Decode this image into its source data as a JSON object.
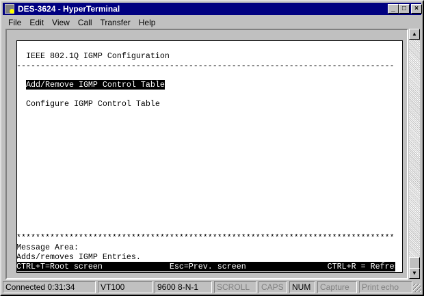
{
  "window": {
    "title": "DES-3624 - HyperTerminal",
    "min": "_",
    "max": "□",
    "close": "×"
  },
  "menu": [
    "File",
    "Edit",
    "View",
    "Call",
    "Transfer",
    "Help"
  ],
  "terminal": {
    "title": "IEEE 802.1Q IGMP Configuration",
    "divider": "-------------------------------------------------------------------------------",
    "items": [
      "Add/Remove IGMP Control Table",
      "Configure IGMP Control Table"
    ],
    "stars": "*******************************************************************************",
    "message_label": "Message Area:",
    "message": "Adds/removes IGMP Entries.",
    "footer": "CTRL+T=Root screen              Esc=Prev. screen                 CTRL+R = Refresh"
  },
  "status": {
    "connected": "Connected 0:31:34",
    "emulation": "VT100",
    "port": "9600 8-N-1",
    "scroll": "SCROLL",
    "caps": "CAPS",
    "num": "NUM",
    "capture": "Capture",
    "print": "Print echo"
  }
}
